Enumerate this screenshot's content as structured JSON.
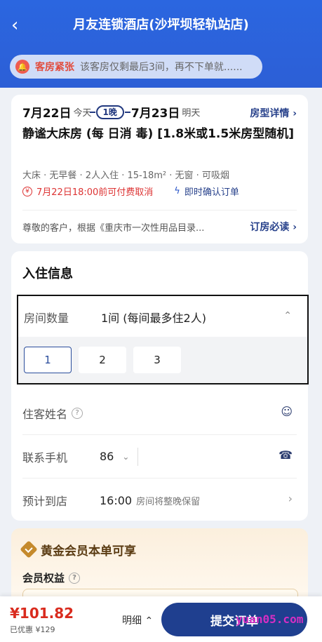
{
  "header": {
    "title": "月友连锁酒店(沙坪坝轻轨站店)",
    "alert_label": "客房紧张",
    "alert_text": "该客房仅剩最后3间，再不下单就......"
  },
  "booking": {
    "checkin_date": "7月22日",
    "checkin_day": "今天",
    "nights": "1晚",
    "checkout_date": "7月23日",
    "checkout_day": "明天",
    "room_detail_link": "房型详情",
    "room_name": "静谧大床房 (每 日消 毒) [1.8米或1.5米房型随机]",
    "room_specs": "大床 · 无早餐 · 2人入住 · 15-18m² · 无窗 · 可吸烟",
    "cancel_policy": "7月22日18:00前可付费取消",
    "instant_confirm": "即时确认订单",
    "notice_text": "尊敬的客户，根据《重庆市一次性用品目录...",
    "must_read": "订房必读"
  },
  "guest_info": {
    "section_title": "入住信息",
    "rooms_label": "房间数量",
    "rooms_value": "1间 (每间最多住2人)",
    "room_options": [
      "1",
      "2",
      "3"
    ],
    "guest_name_label": "住客姓名",
    "phone_label": "联系手机",
    "country_code": "86",
    "arrival_label": "预计到店",
    "arrival_time": "16:00",
    "arrival_note": "房间将整晚保留"
  },
  "membership": {
    "title": "黄金会员本单可享",
    "benefits_label": "会员权益"
  },
  "footer": {
    "price": "¥101.82",
    "discount": "已优惠 ¥129",
    "detail_label": "明细",
    "submit_label": "提交订单",
    "watermark": "yuan05.com"
  },
  "colors": {
    "brand_blue": "#2b66e0",
    "submit_blue": "#1f3f8f",
    "price_red": "#d92b1e",
    "gold": "#c58a2c"
  }
}
